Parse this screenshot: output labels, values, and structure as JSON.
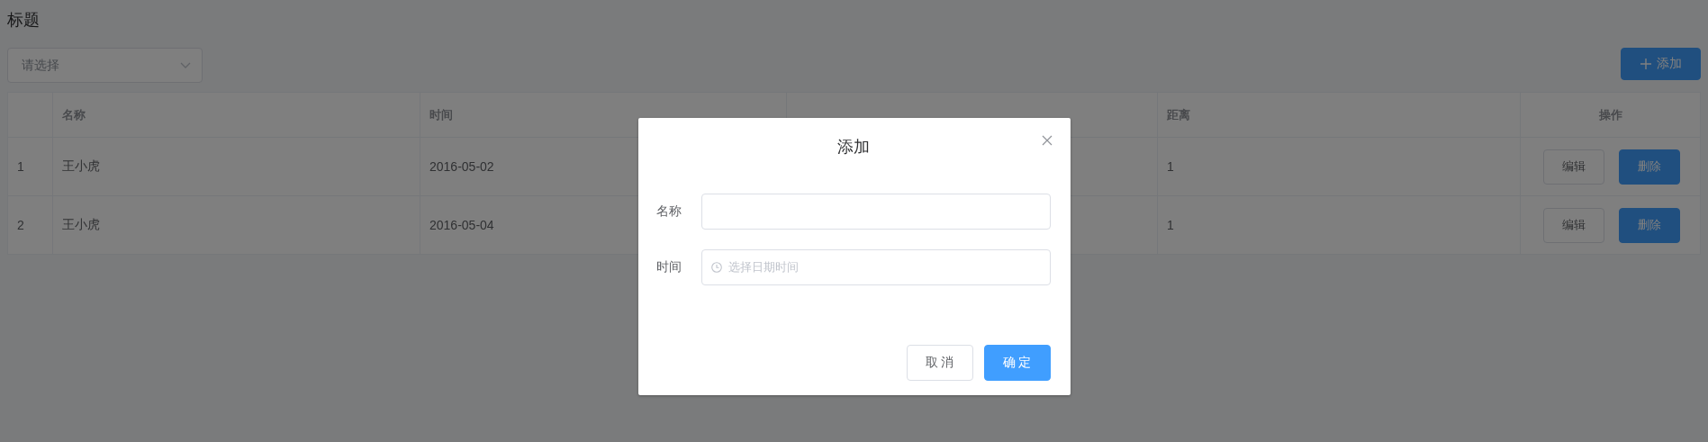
{
  "page": {
    "title": "标题"
  },
  "filter": {
    "placeholder": "请选择"
  },
  "add_button": {
    "label": "添加"
  },
  "table": {
    "columns": [
      {
        "label": "名称"
      },
      {
        "label": "时间"
      },
      {},
      {
        "label": "距离"
      },
      {
        "label": "操作"
      }
    ],
    "rows": [
      {
        "index": "1",
        "name": "王小虎",
        "time": "2016-05-02",
        "distance": "1",
        "actions": [
          {
            "label": "编辑",
            "kind": "default"
          },
          {
            "label": "删除",
            "kind": "primary"
          }
        ]
      },
      {
        "index": "2",
        "name": "王小虎",
        "time": "2016-05-04",
        "distance": "1",
        "actions": [
          {
            "label": "编辑",
            "kind": "default"
          },
          {
            "label": "删除",
            "kind": "primary"
          }
        ]
      }
    ]
  },
  "dialog": {
    "open": true,
    "title": "添加",
    "fields": [
      {
        "label": "名称",
        "kind": "text"
      },
      {
        "label": "时间",
        "kind": "datetime",
        "placeholder": "选择日期时间"
      }
    ],
    "buttons": [
      {
        "label": "取 消",
        "kind": "default"
      },
      {
        "label": "确 定",
        "kind": "primary"
      }
    ]
  }
}
